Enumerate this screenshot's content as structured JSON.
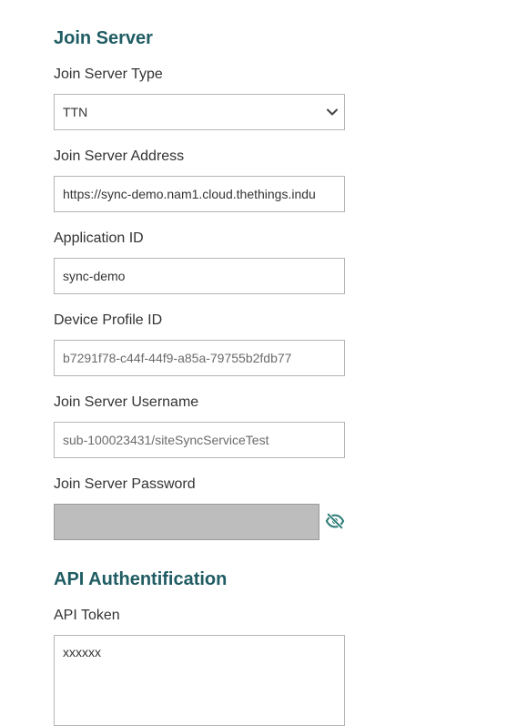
{
  "join_server": {
    "section_title": "Join Server",
    "type_label": "Join Server Type",
    "type_value": "TTN",
    "address_label": "Join Server Address",
    "address_value": "https://sync-demo.nam1.cloud.thethings.indu",
    "app_id_label": "Application ID",
    "app_id_value": "sync-demo",
    "device_profile_label": "Device Profile ID",
    "device_profile_value": "b7291f78-c44f-44f9-a85a-79755b2fdb77",
    "username_label": "Join Server Username",
    "username_value": "sub-100023431/siteSyncServiceTest",
    "password_label": "Join Server Password",
    "password_value": "",
    "password_toggle_icon": "eye-slash-icon"
  },
  "api_auth": {
    "section_title": "API Authentification",
    "token_label": "API Token",
    "token_value": "xxxxxx"
  },
  "colors": {
    "heading": "#1f5c63",
    "accent_icon": "#2e7d78",
    "border": "#b5b5b5",
    "disabled_fill": "#bdbdbd"
  }
}
